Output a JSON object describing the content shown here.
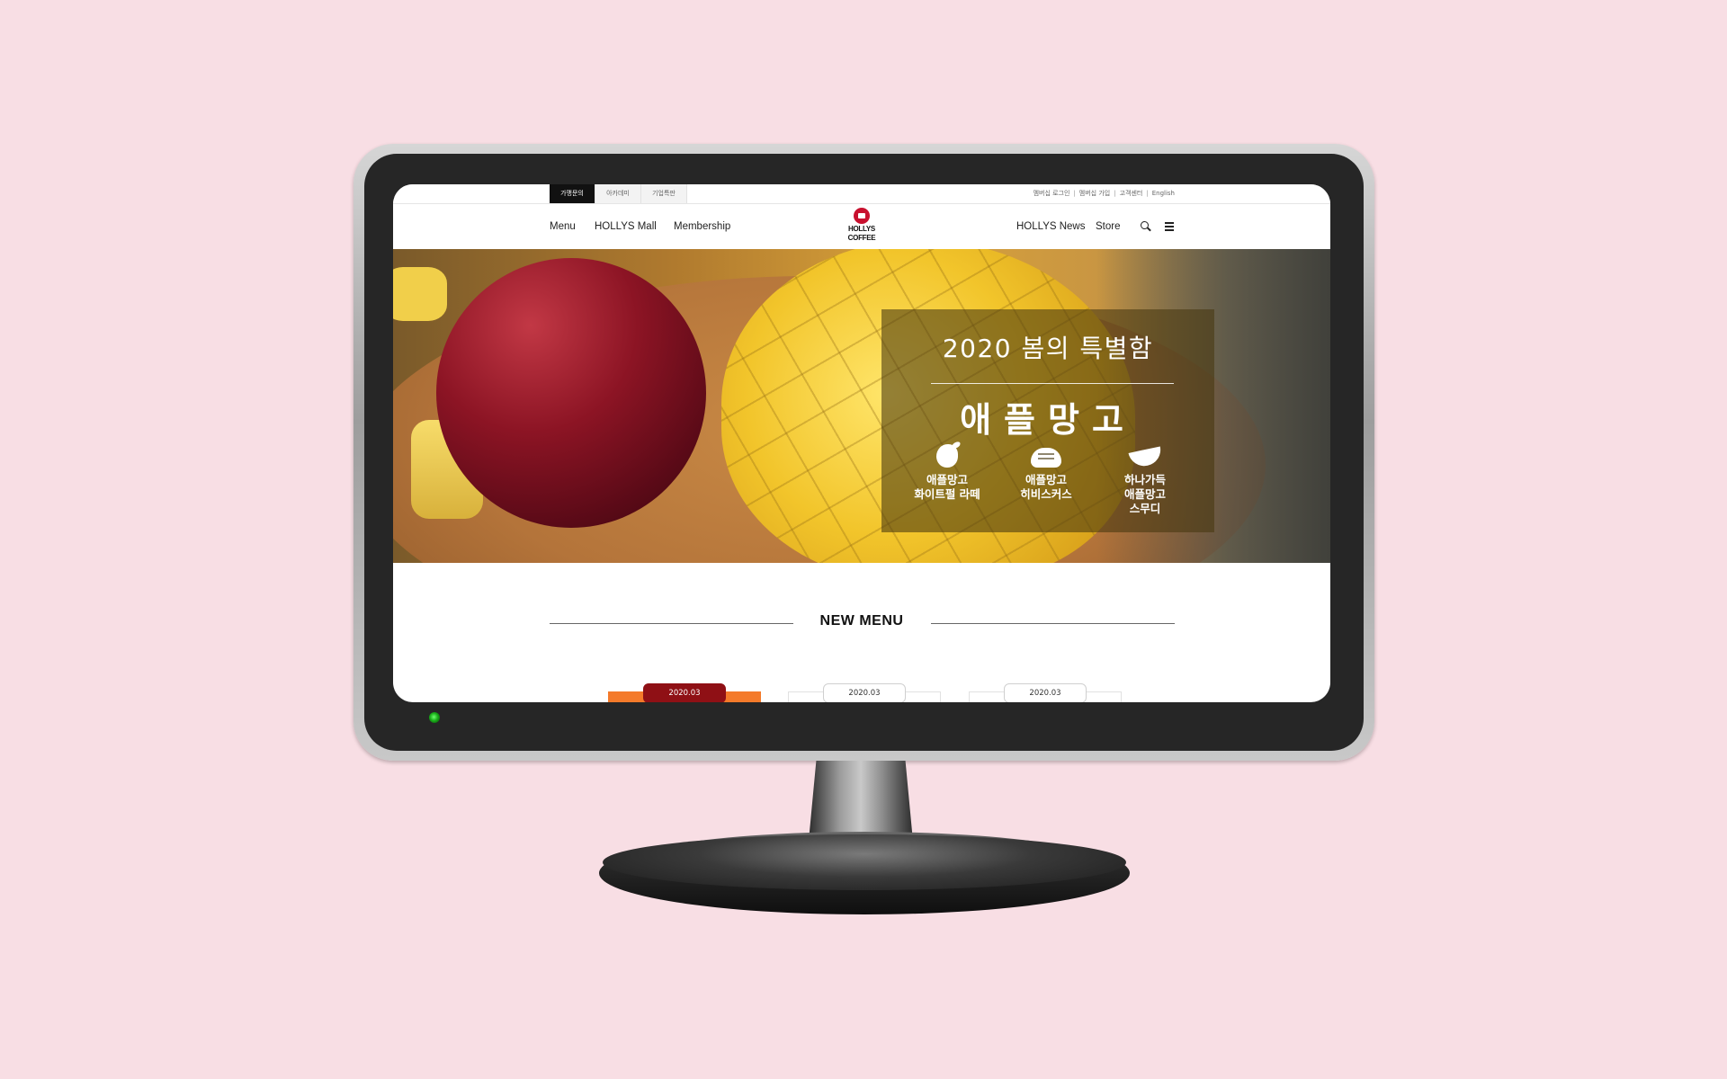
{
  "util": {
    "tabs": [
      "가맹문의",
      "아카데미",
      "기업특판"
    ],
    "links": [
      "멤버십 로그인",
      "멤버십 가입",
      "고객센터",
      "English"
    ],
    "separator": "|"
  },
  "nav": {
    "left": [
      "Menu",
      "HOLLYS Mall",
      "Membership"
    ],
    "right": [
      "HOLLYS News",
      "Store"
    ],
    "logo_line1": "HOLLYS",
    "logo_line2": "COFFEE"
  },
  "hero": {
    "subtitle": "2020 봄의 특별함",
    "title": "애플망고",
    "items": [
      {
        "icon": "mango-icon",
        "lines": [
          "애플망고",
          "화이트펄 라떼"
        ]
      },
      {
        "icon": "half-mango-icon",
        "lines": [
          "애플망고",
          "히비스커스"
        ]
      },
      {
        "icon": "mango-slice-icon",
        "lines": [
          "하나가득",
          "애플망고",
          "스무디"
        ]
      }
    ]
  },
  "new_menu": {
    "title": "NEW MENU",
    "cards": [
      {
        "date": "2020.03",
        "active": true
      },
      {
        "date": "2020.03",
        "active": false
      },
      {
        "date": "2020.03",
        "active": false
      }
    ]
  },
  "colors": {
    "page_bg": "#f8dee4",
    "util_active": "#111111",
    "active_date": "#8f1015",
    "active_card": "#f47a2a",
    "logo_red": "#c8102e"
  }
}
